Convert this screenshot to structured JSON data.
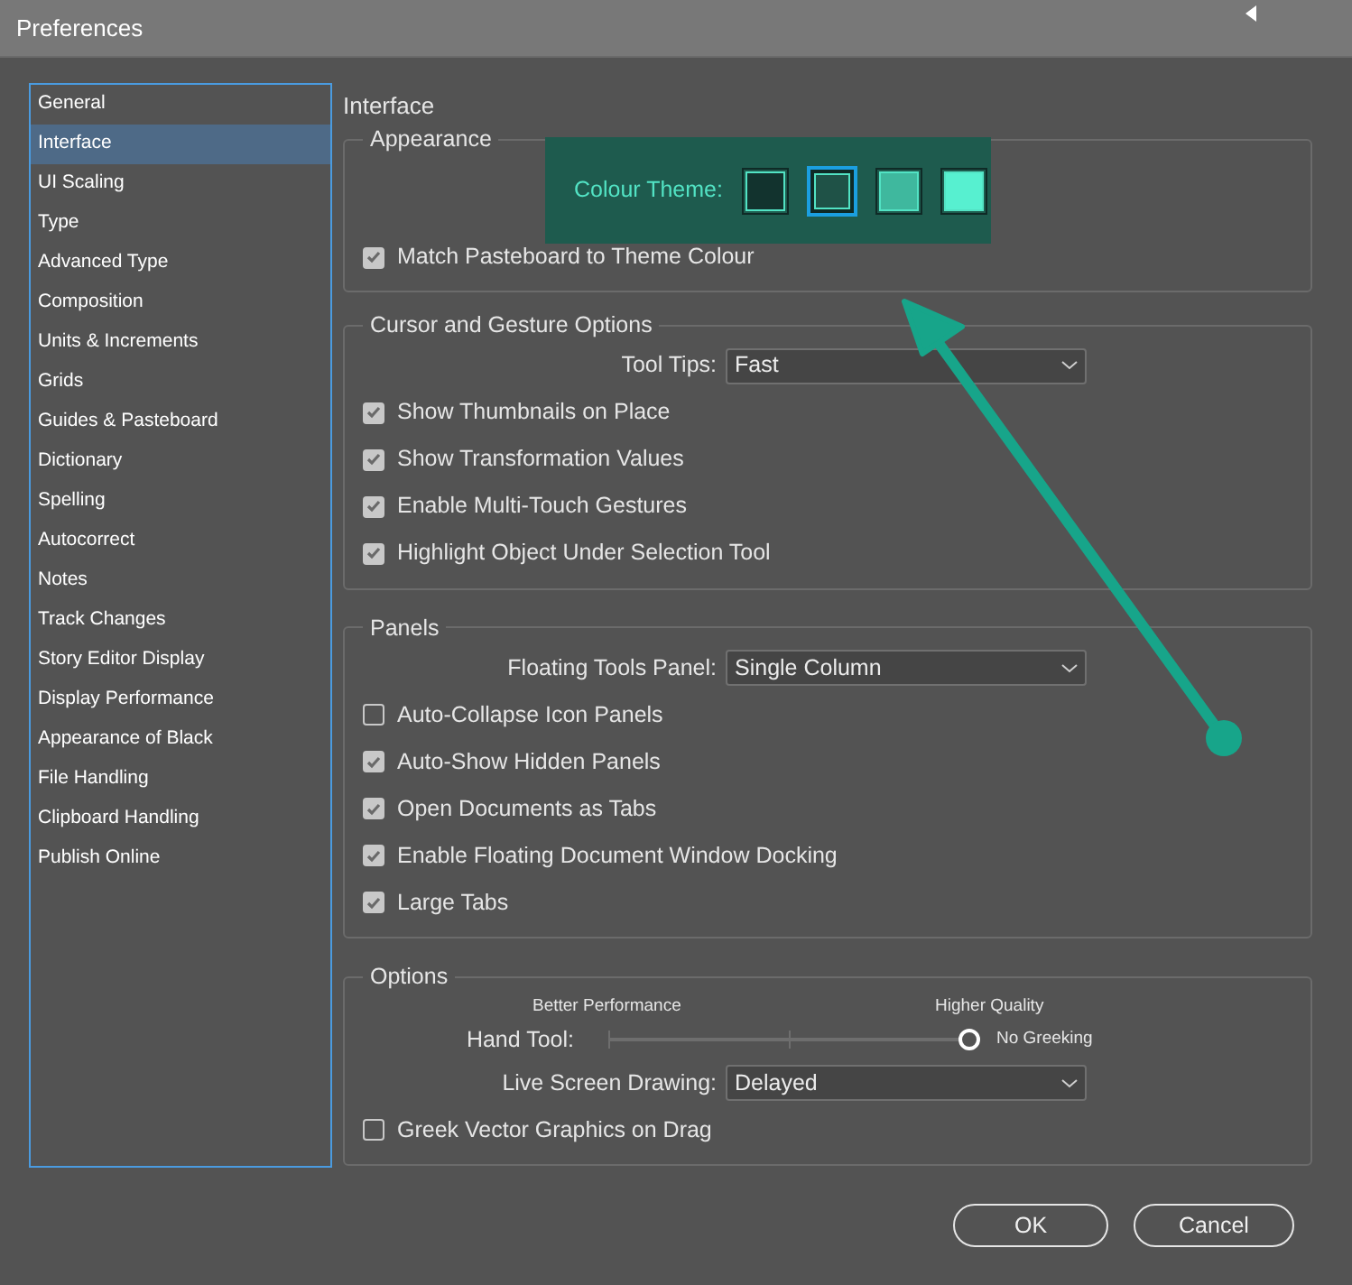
{
  "window": {
    "title": "Preferences"
  },
  "sidebar": {
    "items": [
      {
        "label": "General",
        "selected": false
      },
      {
        "label": "Interface",
        "selected": true
      },
      {
        "label": "UI Scaling",
        "selected": false
      },
      {
        "label": "Type",
        "selected": false
      },
      {
        "label": "Advanced Type",
        "selected": false
      },
      {
        "label": "Composition",
        "selected": false
      },
      {
        "label": "Units & Increments",
        "selected": false
      },
      {
        "label": "Grids",
        "selected": false
      },
      {
        "label": "Guides & Pasteboard",
        "selected": false
      },
      {
        "label": "Dictionary",
        "selected": false
      },
      {
        "label": "Spelling",
        "selected": false
      },
      {
        "label": "Autocorrect",
        "selected": false
      },
      {
        "label": "Notes",
        "selected": false
      },
      {
        "label": "Track Changes",
        "selected": false
      },
      {
        "label": "Story Editor Display",
        "selected": false
      },
      {
        "label": "Display Performance",
        "selected": false
      },
      {
        "label": "Appearance of Black",
        "selected": false
      },
      {
        "label": "File Handling",
        "selected": false
      },
      {
        "label": "Clipboard Handling",
        "selected": false
      },
      {
        "label": "Publish Online",
        "selected": false
      }
    ]
  },
  "heading": "Interface",
  "groups": [
    {
      "title": "Appearance",
      "rows": [
        {
          "kind": "theme",
          "label": "Colour Theme:",
          "swatches": [
            {
              "color": "#12332e",
              "selected": false
            },
            {
              "color": "#1f5247",
              "selected": true
            },
            {
              "color": "#3fb89e",
              "selected": false
            },
            {
              "color": "#57f0d0",
              "selected": false
            }
          ]
        },
        {
          "kind": "checkbox",
          "label": "Match Pasteboard to Theme Colour",
          "checked": true
        }
      ]
    },
    {
      "title": "Cursor and Gesture Options",
      "rows": [
        {
          "kind": "dropdown",
          "label": "Tool Tips:",
          "value": "Fast"
        },
        {
          "kind": "checkbox",
          "label": "Show Thumbnails on Place",
          "checked": true
        },
        {
          "kind": "checkbox",
          "label": "Show Transformation Values",
          "checked": true
        },
        {
          "kind": "checkbox",
          "label": "Enable Multi-Touch Gestures",
          "checked": true
        },
        {
          "kind": "checkbox",
          "label": "Highlight Object Under Selection Tool",
          "checked": true
        }
      ]
    },
    {
      "title": "Panels",
      "rows": [
        {
          "kind": "dropdown",
          "label": "Floating Tools Panel:",
          "value": "Single Column"
        },
        {
          "kind": "checkbox",
          "label": "Auto-Collapse Icon Panels",
          "checked": false
        },
        {
          "kind": "checkbox",
          "label": "Auto-Show Hidden Panels",
          "checked": true
        },
        {
          "kind": "checkbox",
          "label": "Open Documents as Tabs",
          "checked": true
        },
        {
          "kind": "checkbox",
          "label": "Enable Floating Document Window Docking",
          "checked": true
        },
        {
          "kind": "checkbox",
          "label": "Large Tabs",
          "checked": true
        }
      ]
    },
    {
      "title": "Options",
      "rows": [
        {
          "kind": "slider",
          "label": "Hand Tool:",
          "left_label": "Better Performance",
          "right_label": "Higher Quality",
          "level": 1,
          "reading": "No Greeking"
        },
        {
          "kind": "dropdown",
          "label": "Live Screen Drawing:",
          "value": "Delayed"
        },
        {
          "kind": "checkbox",
          "label": "Greek Vector Graphics on Drag",
          "checked": false
        }
      ]
    }
  ],
  "buttons": [
    "OK",
    "Cancel"
  ]
}
